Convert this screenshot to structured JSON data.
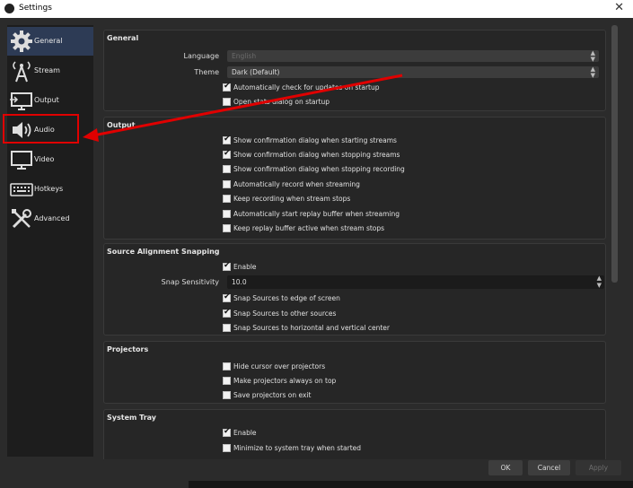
{
  "window": {
    "title": "Settings",
    "close_glyph": "✕"
  },
  "sidebar": {
    "items": [
      {
        "label": "General",
        "icon": "gear-icon"
      },
      {
        "label": "Stream",
        "icon": "antenna-icon"
      },
      {
        "label": "Output",
        "icon": "output-monitor-icon"
      },
      {
        "label": "Audio",
        "icon": "speaker-icon"
      },
      {
        "label": "Video",
        "icon": "monitor-icon"
      },
      {
        "label": "Hotkeys",
        "icon": "keyboard-icon"
      },
      {
        "label": "Advanced",
        "icon": "tools-icon"
      }
    ],
    "active": "General"
  },
  "general": {
    "title": "General",
    "language_label": "Language",
    "language_value": "English",
    "theme_label": "Theme",
    "theme_value": "Dark (Default)",
    "checks": [
      {
        "label": "Automatically check for updates on startup",
        "checked": true
      },
      {
        "label": "Open stats dialog on startup",
        "checked": false
      }
    ]
  },
  "output": {
    "title": "Output",
    "checks": [
      {
        "label": "Show confirmation dialog when starting streams",
        "checked": true
      },
      {
        "label": "Show confirmation dialog when stopping streams",
        "checked": true
      },
      {
        "label": "Show confirmation dialog when stopping recording",
        "checked": false
      },
      {
        "label": "Automatically record when streaming",
        "checked": false
      },
      {
        "label": "Keep recording when stream stops",
        "checked": false
      },
      {
        "label": "Automatically start replay buffer when streaming",
        "checked": false
      },
      {
        "label": "Keep replay buffer active when stream stops",
        "checked": false
      }
    ]
  },
  "snapping": {
    "title": "Source Alignment Snapping",
    "enable_label": "Enable",
    "sensitivity_label": "Snap Sensitivity",
    "sensitivity_value": "10.0",
    "checks": [
      {
        "label": "Snap Sources to edge of screen",
        "checked": true
      },
      {
        "label": "Snap Sources to other sources",
        "checked": true
      },
      {
        "label": "Snap Sources to horizontal and vertical center",
        "checked": false
      }
    ]
  },
  "projectors": {
    "title": "Projectors",
    "checks": [
      {
        "label": "Hide cursor over projectors",
        "checked": false
      },
      {
        "label": "Make projectors always on top",
        "checked": false
      },
      {
        "label": "Save projectors on exit",
        "checked": false
      }
    ]
  },
  "systray": {
    "title": "System Tray",
    "checks": [
      {
        "label": "Enable",
        "checked": true
      },
      {
        "label": "Minimize to system tray when started",
        "checked": false
      }
    ]
  },
  "buttons": {
    "ok": "OK",
    "cancel": "Cancel",
    "apply": "Apply"
  },
  "annotation": {
    "color": "#e00000"
  }
}
